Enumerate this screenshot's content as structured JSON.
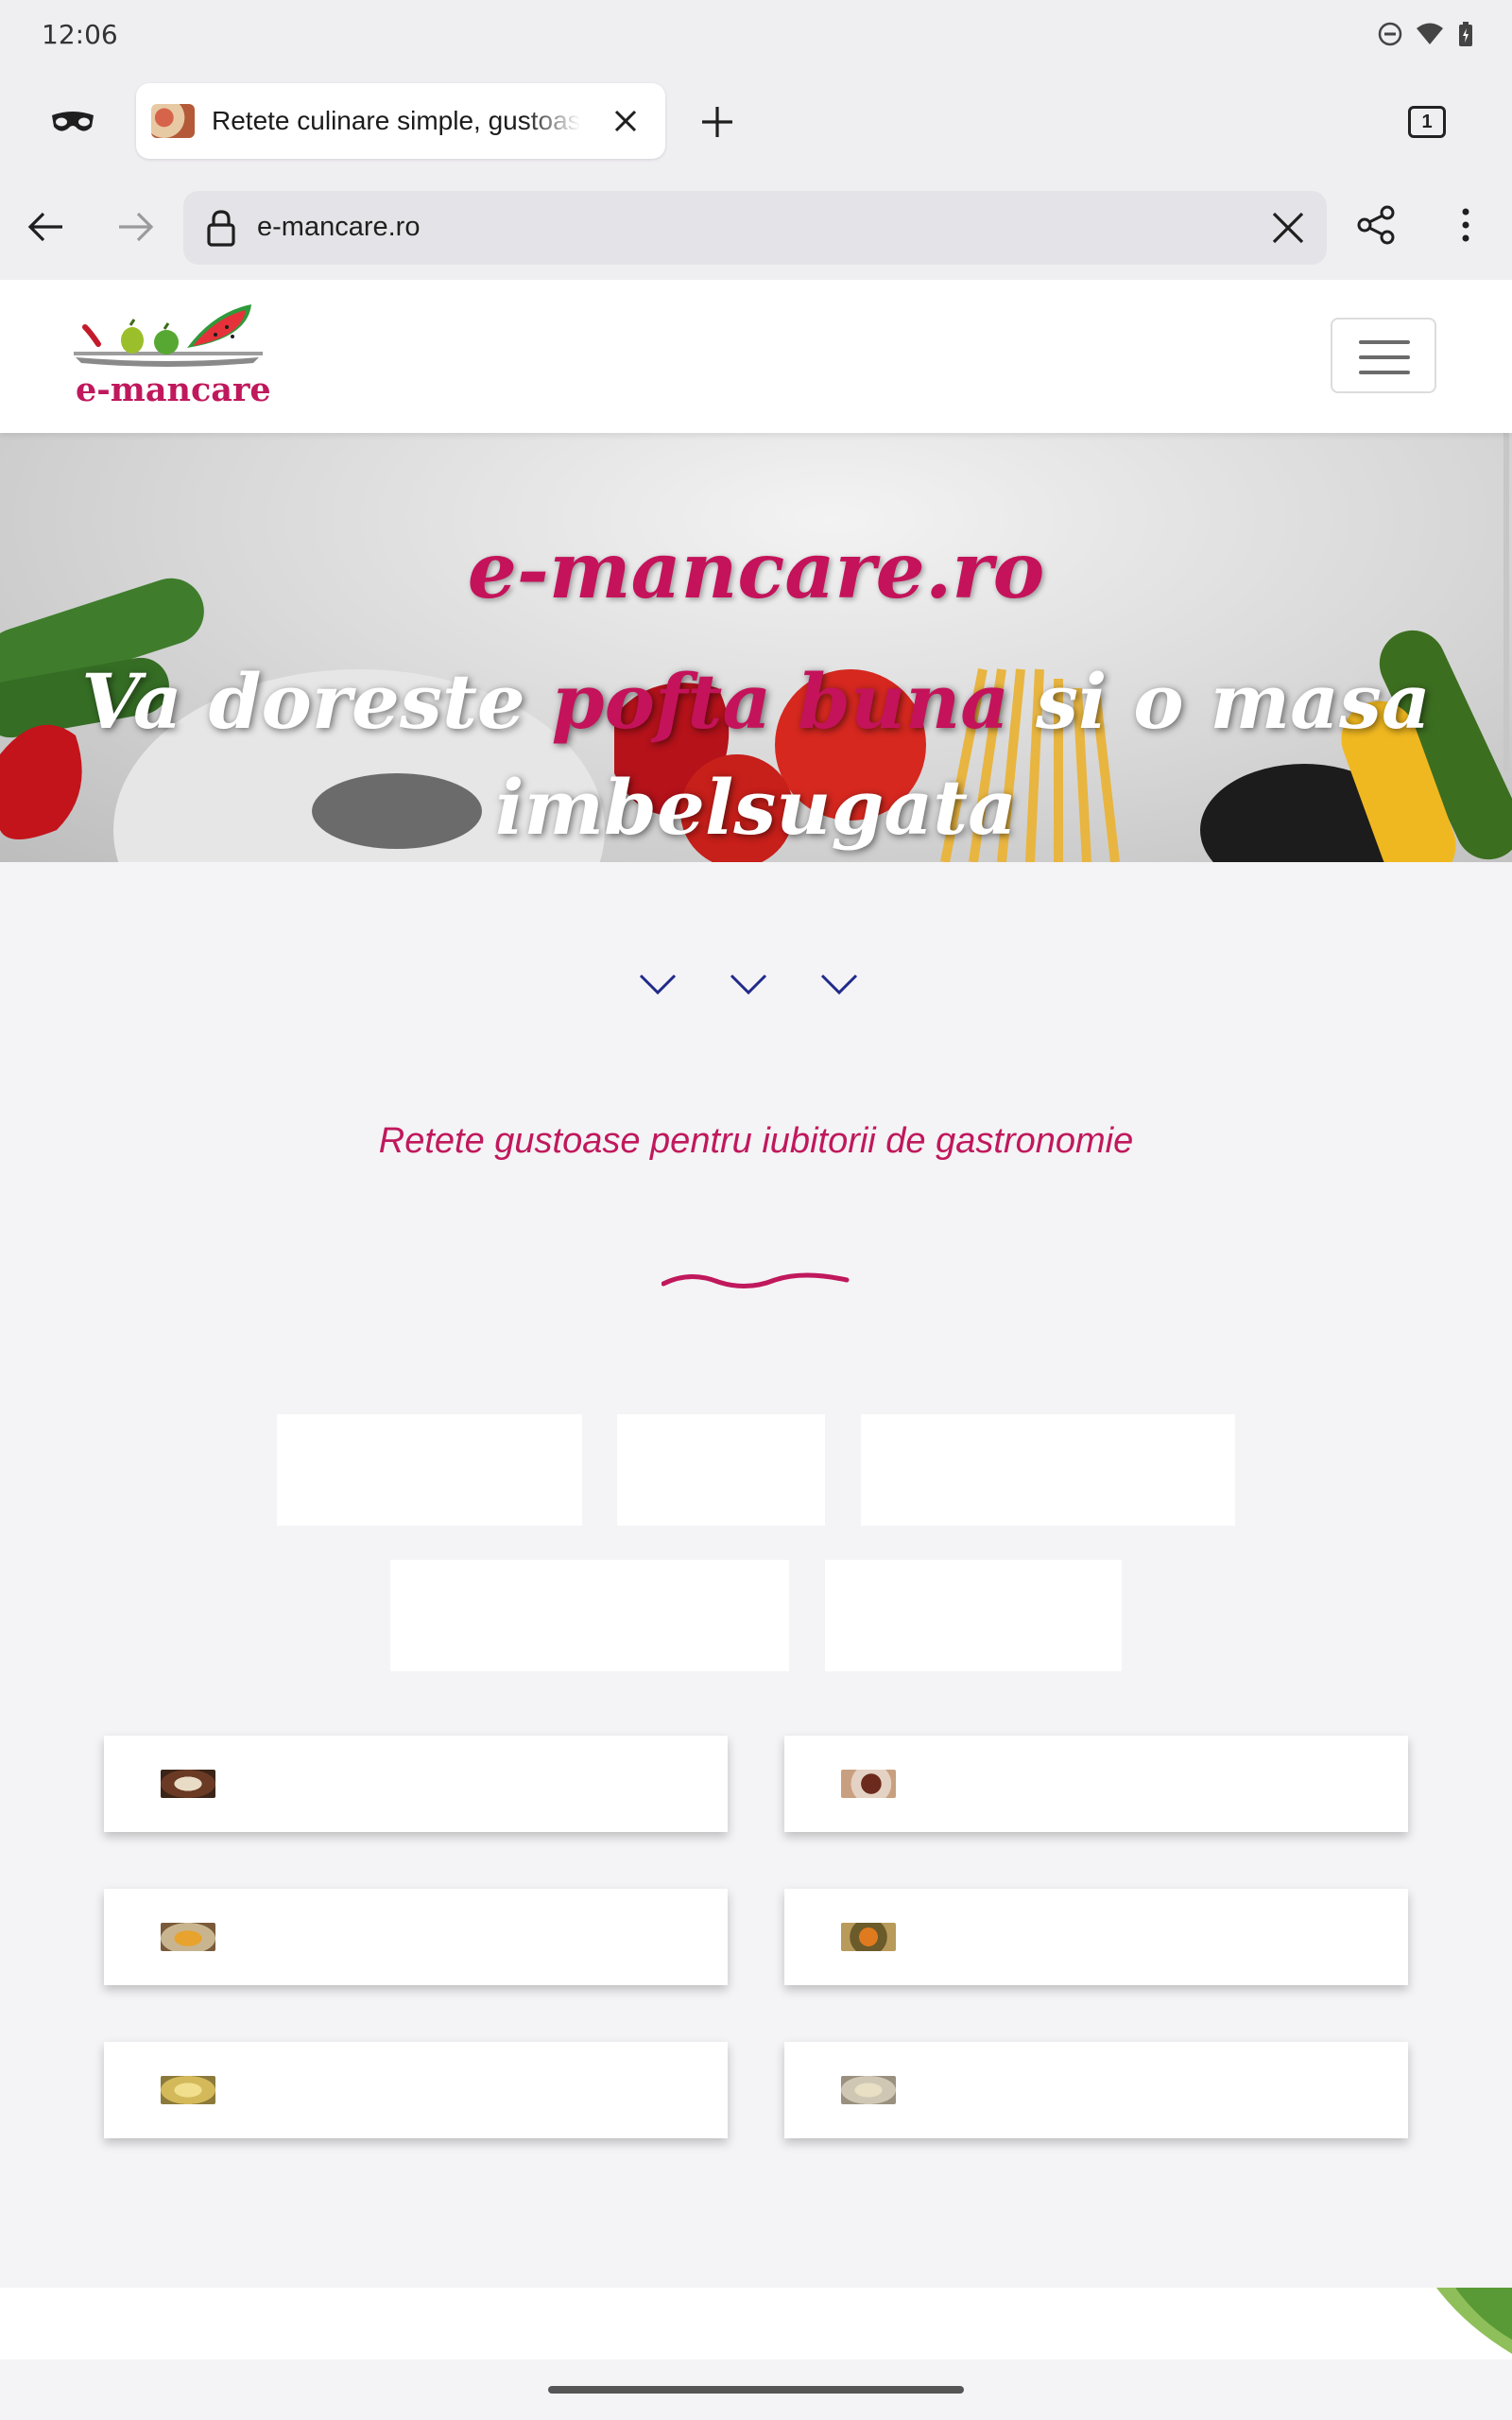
{
  "status_bar": {
    "time": "12:06"
  },
  "browser": {
    "tab": {
      "title": "Retete culinare simple, gustoase"
    },
    "tab_count": "1",
    "url": "e-mancare.ro"
  },
  "site": {
    "logo_text": "e-mancare",
    "hero": {
      "site_name": "e-mancare.ro",
      "tagline_parts": [
        "Va doreste ",
        "pofta buna",
        " si o masa",
        "imbelsugata"
      ]
    },
    "subtitle": "Retete gustoase pentru iubitorii de gastronomie"
  },
  "colors": {
    "brand": "#c0185c",
    "chevron": "#1f2a8a"
  },
  "icons": {
    "incognito": "incognito-icon",
    "close": "close-icon",
    "plus": "plus-icon",
    "back": "arrow-left-icon",
    "forward": "arrow-right-icon",
    "lock": "lock-icon",
    "share": "share-icon",
    "menu": "more-vert-icon",
    "hamburger": "hamburger-menu-icon",
    "scroll_down": "chevron-down-icon"
  }
}
